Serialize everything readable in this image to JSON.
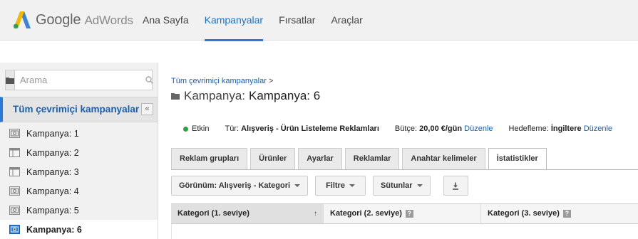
{
  "brand": {
    "google": "Google",
    "product": "AdWords"
  },
  "nav": {
    "items": [
      {
        "label": "Ana Sayfa"
      },
      {
        "label": "Kampanyalar"
      },
      {
        "label": "Fırsatlar"
      },
      {
        "label": "Araçlar"
      }
    ],
    "active": "Kampanyalar"
  },
  "sidebar": {
    "search_placeholder": "Arama",
    "all_campaigns": "Tüm çevrimiçi kampanyalar",
    "collapse_glyph": "«",
    "campaigns": [
      {
        "label": "Kampanya: 1",
        "icon": "shopping-campaign-icon"
      },
      {
        "label": "Kampanya: 2",
        "icon": "search-campaign-icon"
      },
      {
        "label": "Kampanya: 3",
        "icon": "search-campaign-icon"
      },
      {
        "label": "Kampanya: 4",
        "icon": "shopping-campaign-icon"
      },
      {
        "label": "Kampanya: 5",
        "icon": "shopping-campaign-icon"
      },
      {
        "label": "Kampanya: 6",
        "icon": "shopping-campaign-icon",
        "selected": true
      }
    ]
  },
  "main": {
    "breadcrumb": "Tüm çevrimiçi kampanyalar",
    "breadcrumb_sep": ">",
    "title_label": "Kampanya:",
    "title_value": "Kampanya: 6",
    "status": "Etkin",
    "type_label": "Tür:",
    "type_value": "Alışveriş - Ürün Listeleme Reklamları",
    "budget_label": "Bütçe:",
    "budget_value": "20,00 €/gün",
    "budget_edit": "Düzenle",
    "targeting_label": "Hedefleme:",
    "targeting_value": "İngiltere",
    "targeting_edit": "Düzenle",
    "tabs": [
      {
        "label": "Reklam grupları"
      },
      {
        "label": "Ürünler"
      },
      {
        "label": "Ayarlar"
      },
      {
        "label": "Reklamlar"
      },
      {
        "label": "Anahtar kelimeler"
      },
      {
        "label": "İstatistikler",
        "active": true
      }
    ],
    "toolbar": {
      "view": "Görünüm: Alışveriş - Kategori",
      "filter": "Filtre",
      "columns": "Sütunlar"
    },
    "table": {
      "columns": [
        {
          "label": "Kategori (1. seviye)",
          "sort": "↑"
        },
        {
          "label": "Kategori (2. seviye)",
          "help": "?"
        },
        {
          "label": "Kategori (3. seviye)",
          "help": "?"
        }
      ]
    }
  },
  "colors": {
    "accent": "#2c7ad6",
    "link": "#1a5fad",
    "status_active": "#2ea043"
  }
}
